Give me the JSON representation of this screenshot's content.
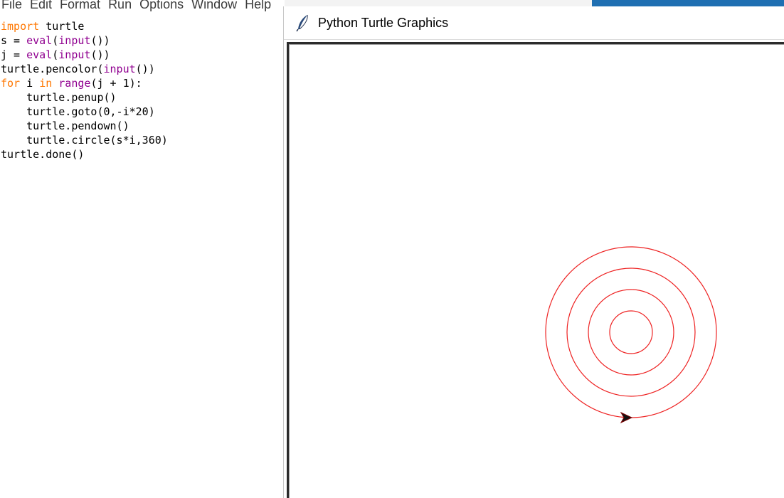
{
  "idle": {
    "menu": [
      "File",
      "Edit",
      "Format",
      "Run",
      "Options",
      "Window",
      "Help"
    ],
    "code": [
      [
        {
          "t": "import",
          "c": "kw"
        },
        {
          "t": " turtle",
          "c": ""
        }
      ],
      [
        {
          "t": "s = ",
          "c": ""
        },
        {
          "t": "eval",
          "c": "bi"
        },
        {
          "t": "(",
          "c": ""
        },
        {
          "t": "input",
          "c": "bi"
        },
        {
          "t": "())",
          "c": ""
        }
      ],
      [
        {
          "t": "j = ",
          "c": ""
        },
        {
          "t": "eval",
          "c": "bi"
        },
        {
          "t": "(",
          "c": ""
        },
        {
          "t": "input",
          "c": "bi"
        },
        {
          "t": "())",
          "c": ""
        }
      ],
      [
        {
          "t": "turtle.pencolor(",
          "c": ""
        },
        {
          "t": "input",
          "c": "bi"
        },
        {
          "t": "())",
          "c": ""
        }
      ],
      [
        {
          "t": "for",
          "c": "kw"
        },
        {
          "t": " i ",
          "c": ""
        },
        {
          "t": "in",
          "c": "kw"
        },
        {
          "t": " ",
          "c": ""
        },
        {
          "t": "range",
          "c": "bi"
        },
        {
          "t": "(j + 1):",
          "c": ""
        }
      ],
      [
        {
          "t": "    turtle.penup()",
          "c": ""
        }
      ],
      [
        {
          "t": "    turtle.goto(0,-i*20)",
          "c": ""
        }
      ],
      [
        {
          "t": "    turtle.pendown()",
          "c": ""
        }
      ],
      [
        {
          "t": "    turtle.circle(s*i,360)",
          "c": ""
        }
      ],
      [
        {
          "t": "turtle.done()",
          "c": ""
        }
      ]
    ]
  },
  "turtle_window": {
    "title": "Python Turtle Graphics",
    "pen_color": "#ee2222",
    "turtle_color": "#111111",
    "circle_count": 4,
    "circle_radii": [
      30,
      60,
      90,
      120
    ],
    "icon": "feather-icon"
  },
  "colors": {
    "keyword": "#ff7700",
    "builtin": "#900090",
    "desktop_blue": "#1f6fb2"
  }
}
